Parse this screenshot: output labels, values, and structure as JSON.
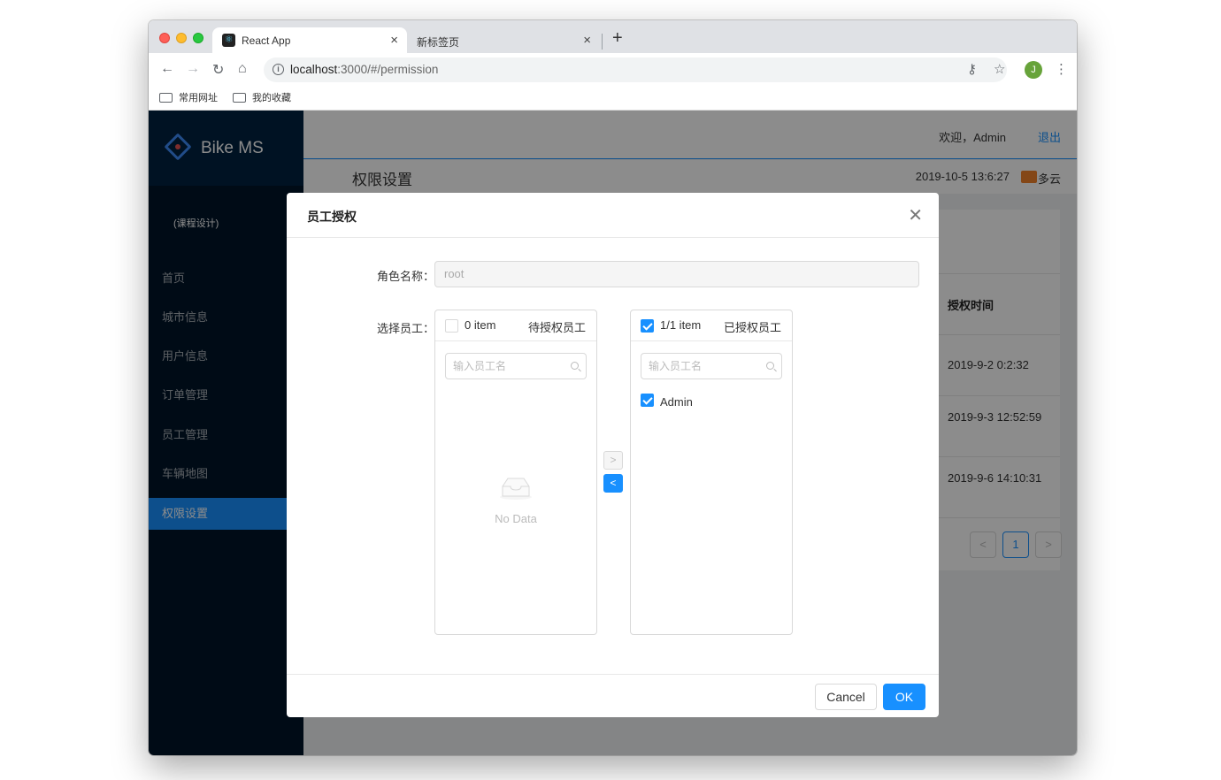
{
  "browser": {
    "tabs": [
      {
        "label": "React App",
        "favicon": "react-icon"
      },
      {
        "label": "新标签页"
      }
    ],
    "url_host": "localhost",
    "url_path": ":3000/#/permission",
    "profile_initial": "J",
    "bookmarks": [
      "常用网址",
      "我的收藏"
    ]
  },
  "app": {
    "logo": "Bike MS",
    "subtitle": "(课程设计)",
    "menu": [
      "首页",
      "城市信息",
      "用户信息",
      "订单管理",
      "员工管理",
      "车辆地图",
      "权限设置"
    ],
    "selected_menu": "权限设置",
    "welcome": "欢迎，Admin",
    "logout": "退出",
    "page_title": "权限设置",
    "datetime": "2019-10-5 13:6:27",
    "weather": "多云",
    "accent_color": "#1890ff"
  },
  "table": {
    "column_auth_time": "授权时间",
    "rows": [
      "2019-9-2 0:2:32",
      "2019-9-3 12:52:59",
      "2019-9-6 14:10:31"
    ],
    "pagination": {
      "prev": "<",
      "current": "1",
      "next": ">"
    }
  },
  "modal": {
    "title": "员工授权",
    "role_label": "角色名称：",
    "role_value": "root",
    "select_label": "选择员工：",
    "source": {
      "count": "0 item",
      "title": "待授权员工",
      "search_placeholder": "输入员工名",
      "empty": "No Data"
    },
    "target": {
      "count": "1/1 item",
      "title": "已授权员工",
      "search_placeholder": "输入员工名",
      "items": [
        "Admin"
      ]
    },
    "move_right": ">",
    "move_left": "<",
    "cancel": "Cancel",
    "ok": "OK"
  }
}
